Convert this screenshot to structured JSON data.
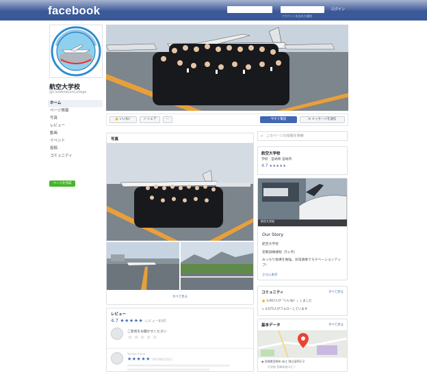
{
  "topbar": {
    "logo": "facebook",
    "login_label": "ログイン",
    "forgot_label": "アカウントを忘れた場合"
  },
  "profile": {
    "name": "航空大学校",
    "handle": "@CivilAviationCollege"
  },
  "nav": {
    "items": [
      {
        "label": "ホーム",
        "active": true
      },
      {
        "label": "ページ情報",
        "active": false
      },
      {
        "label": "写真",
        "active": false
      },
      {
        "label": "レビュー",
        "active": false
      },
      {
        "label": "動画",
        "active": false
      },
      {
        "label": "イベント",
        "active": false
      },
      {
        "label": "投稿",
        "active": false
      },
      {
        "label": "コミュニティ",
        "active": false
      }
    ],
    "create_page": "ページを作成"
  },
  "actions": {
    "like": "いいね！",
    "share": "シェア",
    "more": "···",
    "call": "今すぐ電話",
    "message": "メッセージを送信"
  },
  "photos": {
    "title": "写真",
    "see_all": "すべて見る"
  },
  "reviews": {
    "title": "レビュー",
    "rating": "4.7",
    "stars": "★★★★★",
    "count": "レビュー83件",
    "prompt": "ご意見をお聞かせください",
    "empty_stars": "★★★★★",
    "reviewer_name": "Yusuke Inoue",
    "reviewer_stars": "★★★★★",
    "reviewer_date": "2017年6月22日"
  },
  "search_page": {
    "placeholder": "このページの投稿を検索"
  },
  "info": {
    "name": "航空大学校",
    "category": "学校 · 宮崎県 宮崎市",
    "rating": "4.7",
    "stars": "★★★★★"
  },
  "story": {
    "photo_caption": "航空大学校",
    "title": "Our Story",
    "line1": "航空大学校",
    "line2": "定期訓練課程（5ヶ月）",
    "line3": "みっちり指導を勉強、非常識事でモチベーションアップ！",
    "more": "さらに表示"
  },
  "community": {
    "title": "コミュニティ",
    "see_all": "すべて見る",
    "likes": "3,067人が「いいね！」しました",
    "follows": "4,075人がフォローしています"
  },
  "basic": {
    "title": "基本データ",
    "see_all": "すべて見る",
    "address": "宮崎県宮崎市 赤江 飛江田652-2",
    "sub": "大学校 宮崎本校ロビー"
  },
  "colors": {
    "fb_blue": "#3b5998",
    "button_blue": "#4267b2",
    "green": "#42b72a"
  }
}
